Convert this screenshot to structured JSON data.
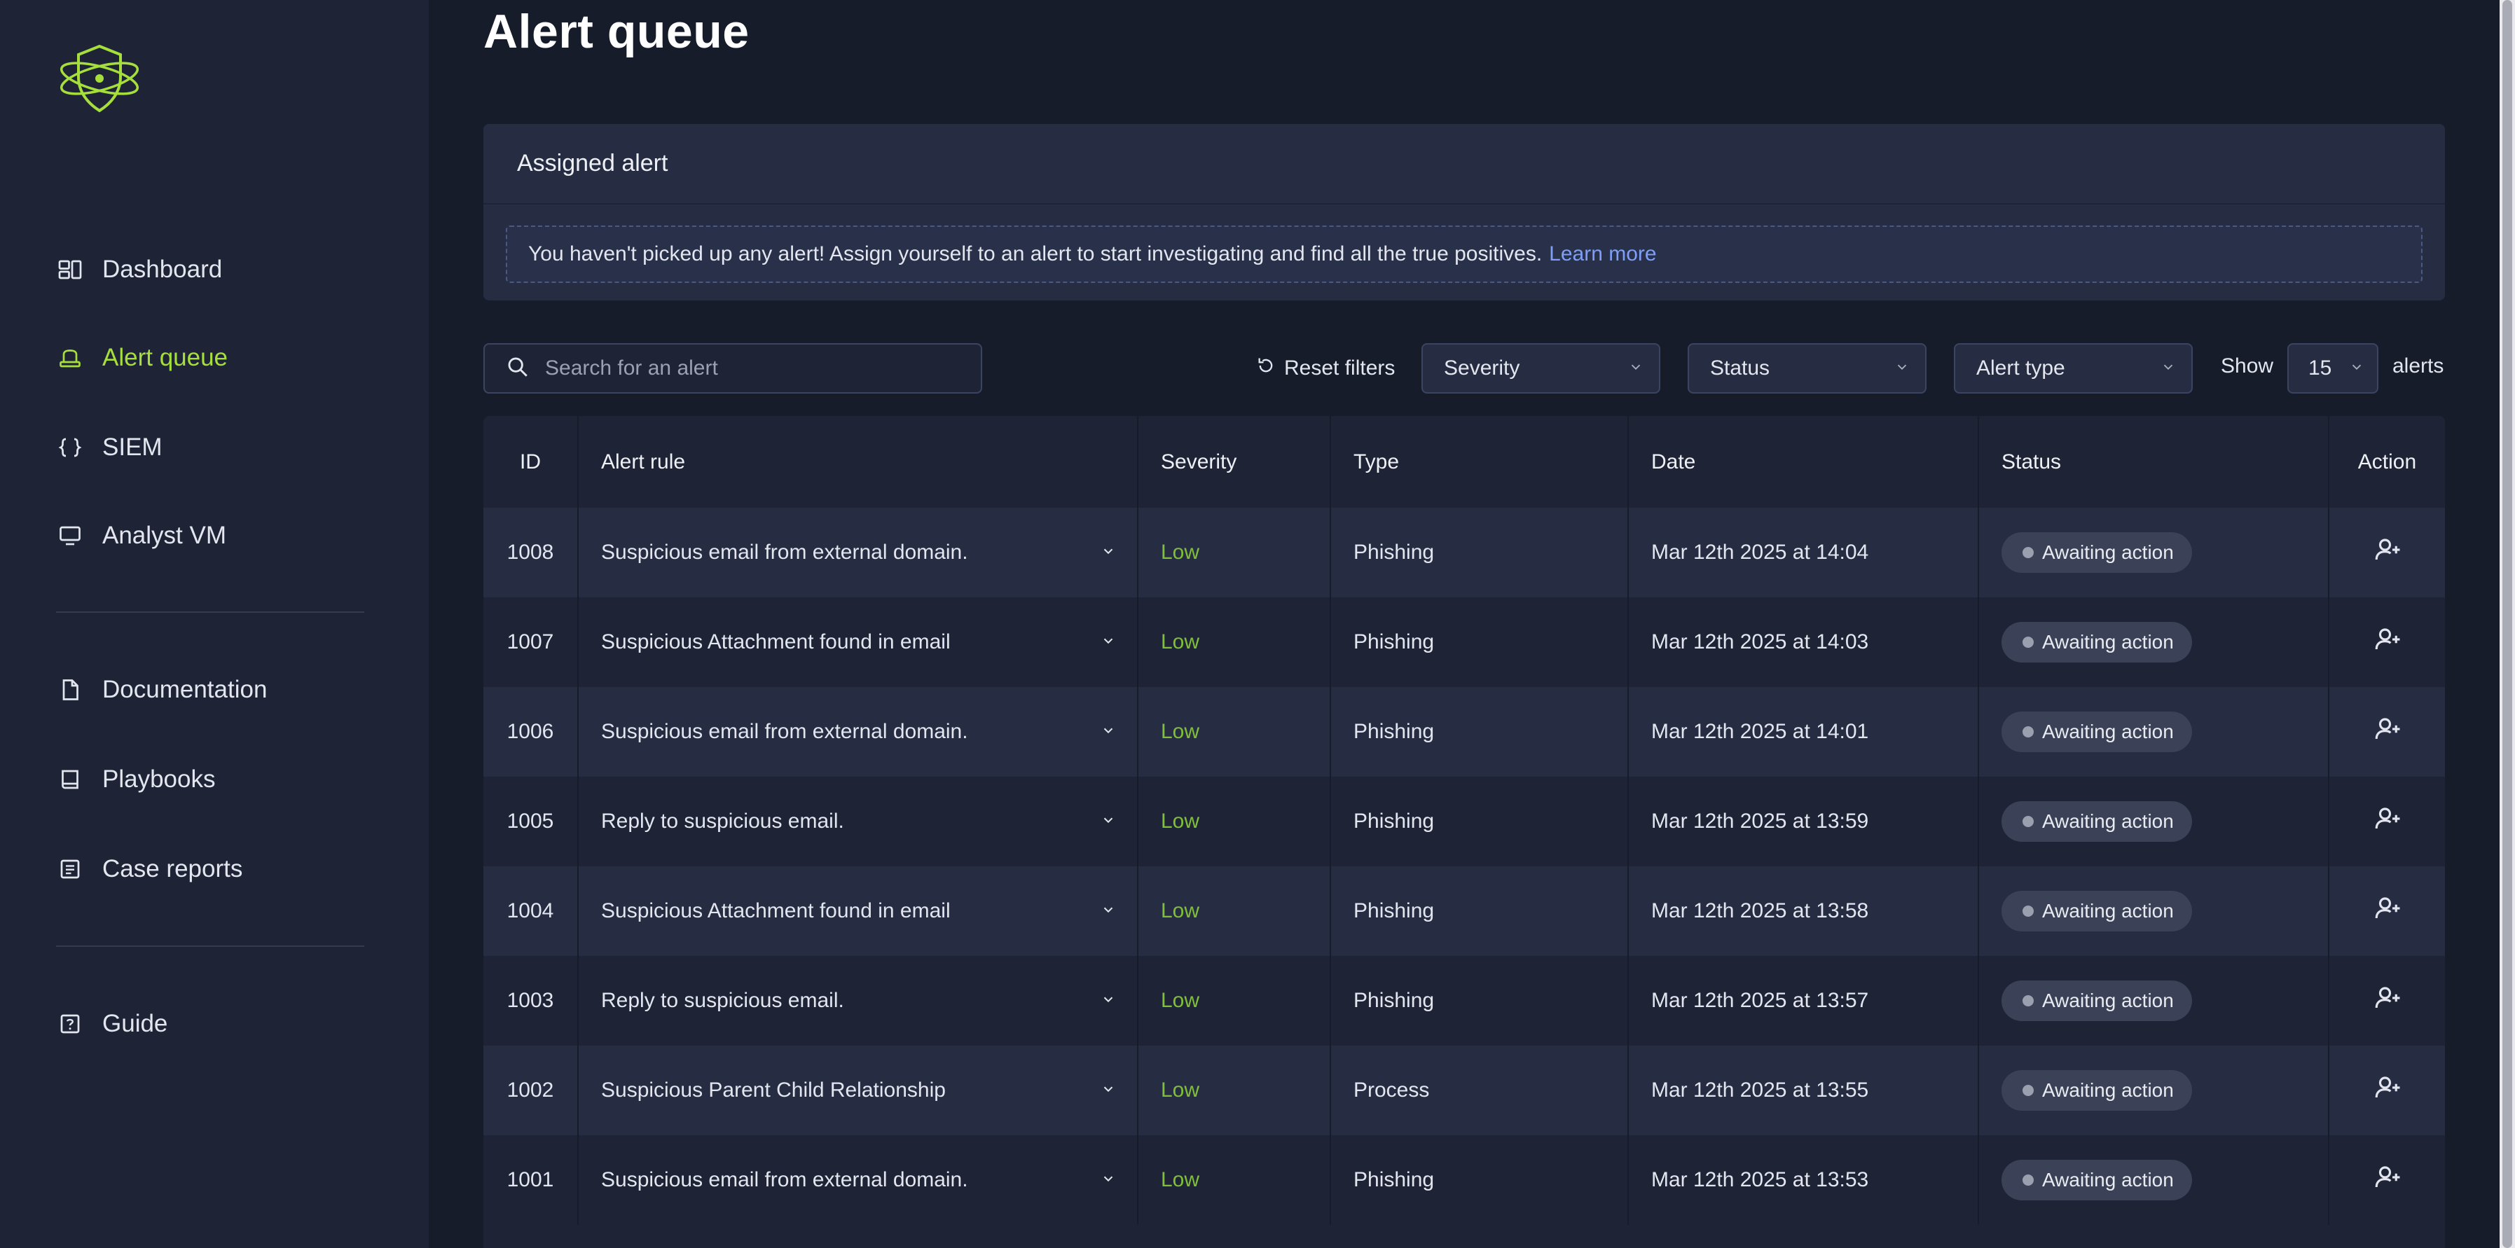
{
  "sidebar": {
    "logo_icon": "shield-atom-logo",
    "items": [
      {
        "label": "Dashboard",
        "icon": "dashboard-icon",
        "active": false
      },
      {
        "label": "Alert queue",
        "icon": "alert-queue-icon",
        "active": true
      },
      {
        "label": "SIEM",
        "icon": "braces-icon",
        "active": false
      },
      {
        "label": "Analyst VM",
        "icon": "monitor-icon",
        "active": false
      },
      {
        "label": "Documentation",
        "icon": "document-icon",
        "active": false
      },
      {
        "label": "Playbooks",
        "icon": "book-icon",
        "active": false
      },
      {
        "label": "Case reports",
        "icon": "report-icon",
        "active": false
      },
      {
        "label": "Guide",
        "icon": "help-icon",
        "active": false
      }
    ]
  },
  "page": {
    "title": "Alert queue"
  },
  "assigned": {
    "header": "Assigned alert",
    "message": "You haven't picked up any alert! Assign yourself to an alert to start investigating and find all the true positives.",
    "link": "Learn more"
  },
  "filters": {
    "search_placeholder": "Search for an alert",
    "reset_label": "Reset filters",
    "severity_label": "Severity",
    "status_label": "Status",
    "alert_type_label": "Alert type",
    "show_label": "Show",
    "show_value": "15",
    "alerts_label": "alerts"
  },
  "table": {
    "columns": [
      "ID",
      "Alert rule",
      "Severity",
      "Type",
      "Date",
      "Status",
      "Action"
    ],
    "rows": [
      {
        "id": "1008",
        "rule": "Suspicious email from external domain.",
        "severity": "Low",
        "type": "Phishing",
        "date": "Mar 12th 2025 at 14:04",
        "status": "Awaiting action"
      },
      {
        "id": "1007",
        "rule": "Suspicious Attachment found in email",
        "severity": "Low",
        "type": "Phishing",
        "date": "Mar 12th 2025 at 14:03",
        "status": "Awaiting action"
      },
      {
        "id": "1006",
        "rule": "Suspicious email from external domain.",
        "severity": "Low",
        "type": "Phishing",
        "date": "Mar 12th 2025 at 14:01",
        "status": "Awaiting action"
      },
      {
        "id": "1005",
        "rule": "Reply to suspicious email.",
        "severity": "Low",
        "type": "Phishing",
        "date": "Mar 12th 2025 at 13:59",
        "status": "Awaiting action"
      },
      {
        "id": "1004",
        "rule": "Suspicious Attachment found in email",
        "severity": "Low",
        "type": "Phishing",
        "date": "Mar 12th 2025 at 13:58",
        "status": "Awaiting action"
      },
      {
        "id": "1003",
        "rule": "Reply to suspicious email.",
        "severity": "Low",
        "type": "Phishing",
        "date": "Mar 12th 2025 at 13:57",
        "status": "Awaiting action"
      },
      {
        "id": "1002",
        "rule": "Suspicious Parent Child Relationship",
        "severity": "Low",
        "type": "Process",
        "date": "Mar 12th 2025 at 13:55",
        "status": "Awaiting action"
      },
      {
        "id": "1001",
        "rule": "Suspicious email from external domain.",
        "severity": "Low",
        "type": "Phishing",
        "date": "Mar 12th 2025 at 13:53",
        "status": "Awaiting action"
      }
    ]
  },
  "colors": {
    "accent": "#a6df3c",
    "severity_low": "#7fbf3a",
    "link": "#7e9ff5"
  }
}
